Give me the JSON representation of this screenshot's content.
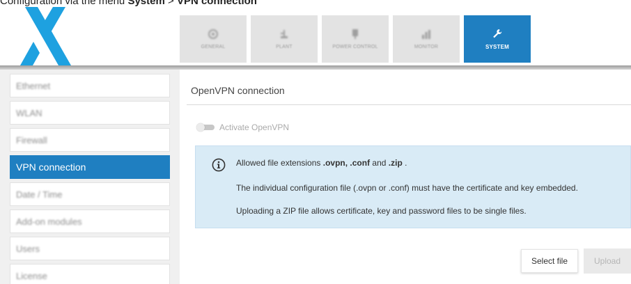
{
  "caption": {
    "prefix": "Configuration via the menu ",
    "menu": "System",
    "separator": " > ",
    "item": "VPN connection"
  },
  "nav": {
    "tabs": [
      {
        "label": "GENERAL",
        "icon": "gauge-icon",
        "active": false
      },
      {
        "label": "PLANT",
        "icon": "plant-icon",
        "active": false
      },
      {
        "label": "POWER CONTROL",
        "icon": "power-control-icon",
        "active": false
      },
      {
        "label": "MONITOR",
        "icon": "monitor-icon",
        "active": false
      },
      {
        "label": "SYSTEM",
        "icon": "wrench-icon",
        "active": true
      }
    ]
  },
  "sidebar": {
    "items": [
      {
        "label": "Ethernet",
        "active": false
      },
      {
        "label": "WLAN",
        "active": false
      },
      {
        "label": "Firewall",
        "active": false
      },
      {
        "label": "VPN connection",
        "active": true
      },
      {
        "label": "Date / Time",
        "active": false
      },
      {
        "label": "Add-on modules",
        "active": false
      },
      {
        "label": "Users",
        "active": false
      },
      {
        "label": "License",
        "active": false
      }
    ]
  },
  "main": {
    "title": "OpenVPN connection",
    "toggle_label": "Activate OpenVPN",
    "toggle_on": false,
    "info": {
      "line1_prefix": "Allowed file extensions ",
      "line1_ext1": ".ovpn, .conf",
      "line1_and": " and ",
      "line1_ext2": ".zip",
      "line1_suffix": " .",
      "line2": "The individual configuration file (.ovpn or .conf) must have the certificate and key embedded.",
      "line3": "Uploading a ZIP file allows certificate, key and password files to be single files."
    },
    "select_file_label": "Select file",
    "upload_label": "Upload"
  },
  "colors": {
    "accent": "#1f7fc1",
    "logo": "#1ea1e0",
    "info_bg": "#d9ebf6"
  }
}
